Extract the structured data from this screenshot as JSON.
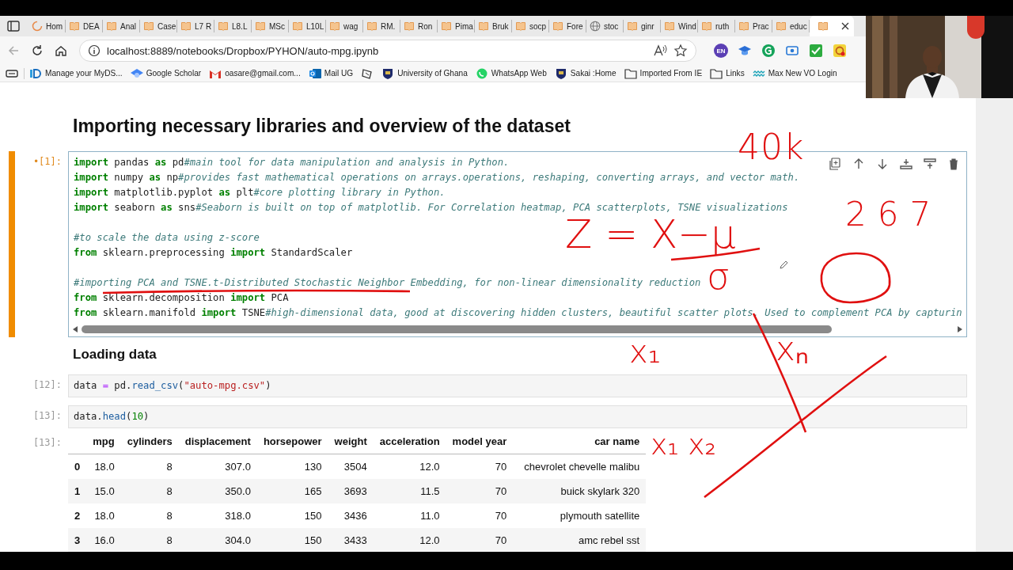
{
  "browser": {
    "tabs": [
      {
        "label": "Hom",
        "kind": "loading",
        "selected": false
      },
      {
        "label": "DEA",
        "kind": "notebook",
        "selected": false
      },
      {
        "label": "Anal",
        "kind": "notebook",
        "selected": false
      },
      {
        "label": "Case",
        "kind": "notebook",
        "selected": false
      },
      {
        "label": "L7 R",
        "kind": "notebook",
        "selected": false
      },
      {
        "label": "L8.L",
        "kind": "notebook",
        "selected": false
      },
      {
        "label": "MSc",
        "kind": "notebook",
        "selected": false
      },
      {
        "label": "L10L",
        "kind": "notebook",
        "selected": false
      },
      {
        "label": "wag",
        "kind": "notebook",
        "selected": false
      },
      {
        "label": "RM.",
        "kind": "notebook",
        "selected": false
      },
      {
        "label": "Ron",
        "kind": "notebook",
        "selected": false
      },
      {
        "label": "Pima",
        "kind": "notebook",
        "selected": false
      },
      {
        "label": "Bruk",
        "kind": "notebook",
        "selected": false
      },
      {
        "label": "socp",
        "kind": "notebook",
        "selected": false
      },
      {
        "label": "Fore",
        "kind": "notebook",
        "selected": false
      },
      {
        "label": "stoc",
        "kind": "globe",
        "selected": false
      },
      {
        "label": "ginr",
        "kind": "notebook",
        "selected": false
      },
      {
        "label": "Wind",
        "kind": "notebook",
        "selected": false
      },
      {
        "label": "ruth",
        "kind": "notebook",
        "selected": false
      },
      {
        "label": "Prac",
        "kind": "notebook",
        "selected": false
      },
      {
        "label": "educ",
        "kind": "notebook",
        "selected": false
      },
      {
        "kind": "notebook",
        "selected": true
      }
    ],
    "address": "localhost:8889/notebooks/Dropbox/PYHON/auto-mpg.ipynb",
    "extension_badge": "EN",
    "bookmarks": [
      {
        "label": "Manage your MyDS...",
        "kind": "logo"
      },
      {
        "label": "Google Scholar",
        "kind": "cap"
      },
      {
        "label": "oasare@gmail.com...",
        "kind": "mail"
      },
      {
        "label": "Mail UG",
        "kind": "mailapp"
      },
      {
        "kind": "link"
      },
      {
        "label": "University of Ghana",
        "kind": "crest"
      },
      {
        "label": "WhatsApp Web",
        "kind": "chat"
      },
      {
        "label": "Sakai :Home",
        "kind": "crest"
      },
      {
        "label": "Imported From IE",
        "kind": "folder"
      },
      {
        "label": "Links",
        "kind": "folder"
      },
      {
        "label": "Max New VO Login",
        "kind": "wave"
      }
    ]
  },
  "notebook": {
    "cells": [
      {
        "kind": "heading",
        "text": "Importing necessary libraries and overview of the dataset"
      },
      {
        "kind": "code",
        "prompt": "•[1]:",
        "selected": true,
        "lines": [
          {
            "tokens": [
              {
                "kind": "kw",
                "text": "import"
              },
              {
                "text": " pandas "
              },
              {
                "kind": "kw",
                "text": "as"
              },
              {
                "text": " pd"
              },
              {
                "kind": "cm",
                "text": "#main tool for data manipulation and analysis in Python."
              }
            ]
          },
          {
            "tokens": [
              {
                "kind": "kw",
                "text": "import"
              },
              {
                "text": " numpy "
              },
              {
                "kind": "kw",
                "text": "as"
              },
              {
                "text": " np"
              },
              {
                "kind": "cm",
                "text": "#provides fast mathematical operations on arrays.operations, reshaping, converting arrays, and vector math."
              }
            ]
          },
          {
            "tokens": [
              {
                "kind": "kw",
                "text": "import"
              },
              {
                "text": " matplotlib.pyplot "
              },
              {
                "kind": "kw",
                "text": "as"
              },
              {
                "text": " plt"
              },
              {
                "kind": "cm",
                "text": "#core plotting library in Python."
              }
            ]
          },
          {
            "tokens": [
              {
                "kind": "kw",
                "text": "import"
              },
              {
                "text": " seaborn "
              },
              {
                "kind": "kw",
                "text": "as"
              },
              {
                "text": " sns"
              },
              {
                "kind": "cm",
                "text": "#Seaborn is built on top of matplotlib. For Correlation heatmap, PCA scatterplots, TSNE visualizations"
              }
            ]
          },
          {
            "blank": true
          },
          {
            "tokens": [
              {
                "kind": "cm",
                "text": "#to scale the data using z-score"
              }
            ]
          },
          {
            "tokens": [
              {
                "kind": "kw",
                "text": "from"
              },
              {
                "text": " sklearn.preprocessing "
              },
              {
                "kind": "kw",
                "text": "import"
              },
              {
                "text": " StandardScaler"
              }
            ]
          },
          {
            "blank": true
          },
          {
            "tokens": [
              {
                "kind": "cm",
                "text": "#importing PCA and TSNE.t-Distributed Stochastic Neighbor Embedding, for non-linear dimensionality reduction"
              }
            ]
          },
          {
            "tokens": [
              {
                "kind": "kw",
                "text": "from"
              },
              {
                "text": " sklearn.decomposition "
              },
              {
                "kind": "kw",
                "text": "import"
              },
              {
                "text": " PCA"
              }
            ]
          },
          {
            "tokens": [
              {
                "kind": "kw",
                "text": "from"
              },
              {
                "text": " sklearn.manifold "
              },
              {
                "kind": "kw",
                "text": "import"
              },
              {
                "text": " TSNE"
              },
              {
                "kind": "cm",
                "text": "#high-dimensional data, good at discovering hidden clusters, beautiful scatter plots, Used to complement PCA by capturin"
              }
            ]
          }
        ]
      },
      {
        "kind": "subheading",
        "text": "Loading data"
      },
      {
        "kind": "code",
        "prompt": "[12]:",
        "selected": false,
        "lines": [
          {
            "tokens": [
              {
                "text": "data "
              },
              {
                "kind": "op",
                "text": "="
              },
              {
                "text": " pd."
              },
              {
                "kind": "fn",
                "text": "read_csv"
              },
              {
                "text": "("
              },
              {
                "kind": "str",
                "text": "\"auto-mpg.csv\""
              },
              {
                "text": ")"
              }
            ]
          }
        ]
      },
      {
        "kind": "code",
        "prompt": "[13]:",
        "selected": false,
        "lines": [
          {
            "tokens": [
              {
                "text": "data."
              },
              {
                "kind": "fn",
                "text": "head"
              },
              {
                "text": "("
              },
              {
                "kind": "num",
                "text": "10"
              },
              {
                "text": ")"
              }
            ]
          }
        ]
      },
      {
        "kind": "table",
        "prompt": "[13]:",
        "columns": [
          "mpg",
          "cylinders",
          "displacement",
          "horsepower",
          "weight",
          "acceleration",
          "model year",
          "car name"
        ],
        "rows": [
          {
            "index": "0",
            "cells": [
              "18.0",
              "8",
              "307.0",
              "130",
              "3504",
              "12.0",
              "70",
              "chevrolet chevelle malibu"
            ]
          },
          {
            "index": "1",
            "cells": [
              "15.0",
              "8",
              "350.0",
              "165",
              "3693",
              "11.5",
              "70",
              "buick skylark 320"
            ]
          },
          {
            "index": "2",
            "cells": [
              "18.0",
              "8",
              "318.0",
              "150",
              "3436",
              "11.0",
              "70",
              "plymouth satellite"
            ]
          },
          {
            "index": "3",
            "cells": [
              "16.0",
              "8",
              "304.0",
              "150",
              "3433",
              "12.0",
              "70",
              "amc rebel sst"
            ]
          }
        ]
      }
    ]
  },
  "annotations": [
    {
      "text": "40k"
    },
    {
      "text": "267"
    },
    {
      "text": "Z = X−μ"
    },
    {
      "text": "σ"
    },
    {
      "text": "x₁"
    },
    {
      "text": "xₙ"
    },
    {
      "text": "x₁ x₂"
    }
  ]
}
